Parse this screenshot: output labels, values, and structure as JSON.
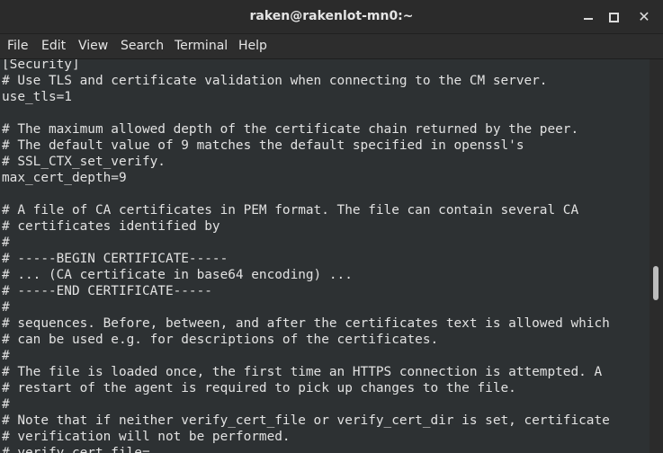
{
  "window": {
    "title": "raken@rakenlot-mn0:~"
  },
  "menu": {
    "items": [
      "File",
      "Edit",
      "View",
      "Search",
      "Terminal",
      "Help"
    ]
  },
  "terminal": {
    "lines": [
      "[Security]",
      "# Use TLS and certificate validation when connecting to the CM server.",
      "use_tls=1",
      "",
      "# The maximum allowed depth of the certificate chain returned by the peer.",
      "# The default value of 9 matches the default specified in openssl's",
      "# SSL_CTX_set_verify.",
      "max_cert_depth=9",
      "",
      "# A file of CA certificates in PEM format. The file can contain several CA",
      "# certificates identified by",
      "#",
      "# -----BEGIN CERTIFICATE-----",
      "# ... (CA certificate in base64 encoding) ...",
      "# -----END CERTIFICATE-----",
      "#",
      "# sequences. Before, between, and after the certificates text is allowed which",
      "# can be used e.g. for descriptions of the certificates.",
      "#",
      "# The file is loaded once, the first time an HTTPS connection is attempted. A",
      "# restart of the agent is required to pick up changes to the file.",
      "#",
      "# Note that if neither verify_cert_file or verify_cert_dir is set, certificate",
      "# verification will not be performed.",
      "# verify_cert_file="
    ]
  }
}
